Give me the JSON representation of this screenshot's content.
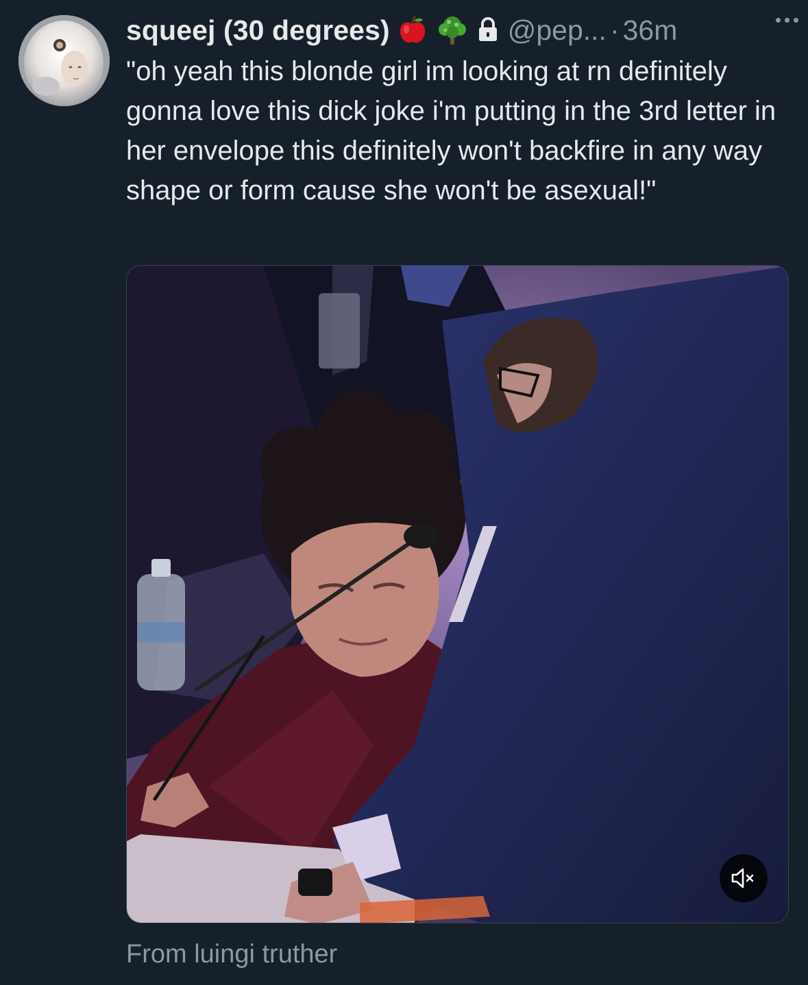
{
  "tweet": {
    "display_name": "squeej (30 degrees)",
    "badges": [
      "red-apple-emoji",
      "tree-emoji",
      "lock-icon"
    ],
    "handle": "@pep...",
    "separator": "·",
    "time": "36m",
    "text": "\"oh yeah this blonde girl im looking at rn definitely gonna love this dick joke i'm putting in the 3rd letter in her envelope this definitely won't backfire in any way shape or form cause she won't be asexual!\"",
    "media": {
      "type": "video",
      "muted": true,
      "mute_icon": "speaker-muted-icon"
    },
    "attribution": "From luingi truther"
  },
  "colors": {
    "background": "#15202b",
    "primary_text": "#e7e9ea",
    "secondary_text": "#8b98a5",
    "border": "#38444d"
  }
}
